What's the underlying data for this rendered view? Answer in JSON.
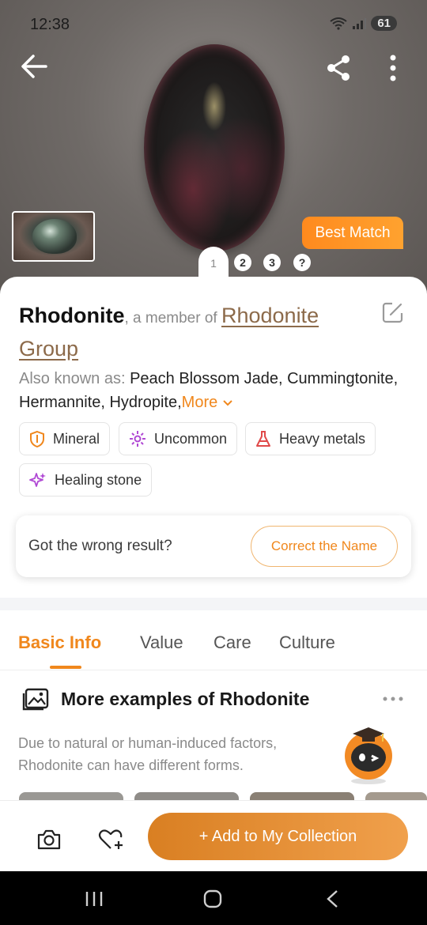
{
  "status": {
    "time": "12:38",
    "battery": "61"
  },
  "hero": {
    "best_match": "Best Match",
    "image_tabs": [
      "1",
      "2",
      "3",
      "?"
    ]
  },
  "identification": {
    "name": "Rhodonite",
    "member_text": ", a member of ",
    "group": "Rhodonite Group",
    "also_known_label": "Also known as: ",
    "also_known_values": "Peach Blossom Jade, Cummingtonite, Hermannite, Hydropite,",
    "more_label": "More"
  },
  "tags": [
    {
      "label": "Mineral",
      "icon": "shield-icon",
      "color": "#f0871c"
    },
    {
      "label": "Uncommon",
      "icon": "sparkle-icon",
      "color": "#b048d4"
    },
    {
      "label": "Heavy metals",
      "icon": "flask-icon",
      "color": "#e04a4a"
    },
    {
      "label": "Healing stone",
      "icon": "stars-icon",
      "color": "#b048d4"
    }
  ],
  "wrong_result": {
    "prompt": "Got the wrong result?",
    "button": "Correct the Name"
  },
  "tabs": [
    "Basic Info",
    "Value",
    "Care",
    "Culture"
  ],
  "more_examples": {
    "title": "More examples of Rhodonite",
    "description": "Due to natural or human-induced factors, Rhodonite can have different forms."
  },
  "bottom_bar": {
    "add_button": "+ Add to My Collection"
  },
  "colors": {
    "accent": "#f0871c",
    "best_match": "#ff9226"
  }
}
